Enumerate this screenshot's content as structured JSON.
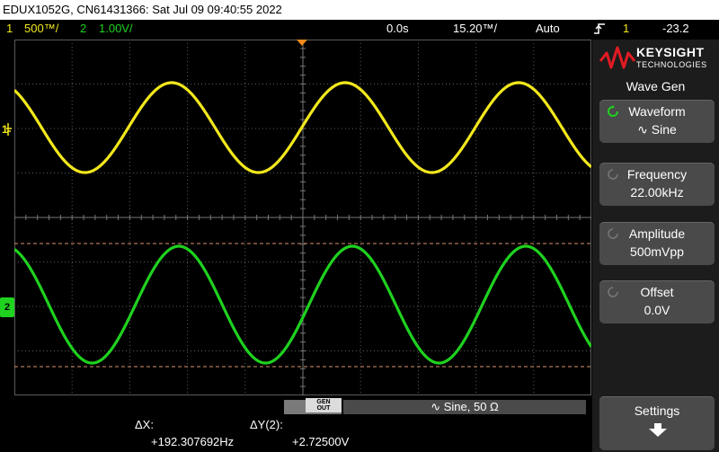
{
  "header": {
    "title": "EDUX1052G, CN61431366: Sat Jul 09 09:40:55 2022"
  },
  "status": {
    "ch1_num": "1",
    "ch1_scale": "500™/",
    "ch2_num": "2",
    "ch2_scale": "1.00V/",
    "delay": "0.0s",
    "timebase": "15.20™/",
    "trigger_mode": "Auto",
    "trigger_icon": "trigger-edge-icon",
    "trigger_source": "1",
    "trigger_level": "-23.2"
  },
  "markers": {
    "ch1": "1",
    "ch2": "2"
  },
  "panel": {
    "brand": "KEYSIGHT",
    "brand_sub": "TECHNOLOGIES",
    "menu_title": "Wave Gen",
    "waveform_label": "Waveform",
    "waveform_value": "∿ Sine",
    "frequency_label": "Frequency",
    "frequency_value": "22.00kHz",
    "amplitude_label": "Amplitude",
    "amplitude_value": "500mVpp",
    "offset_label": "Offset",
    "offset_value": "0.0V",
    "settings_label": "Settings"
  },
  "generator": {
    "gen_out": "GEN\nOUT",
    "info": "∿  Sine, 50 Ω"
  },
  "cursors": {
    "dx_label": "ΔX:",
    "dx_value": "+192.307692Hz",
    "dy_label": "ΔY(2):",
    "dy_value": "+2.72500V"
  },
  "colors": {
    "ch1": "#f2e81c",
    "ch2": "#1fd21f",
    "grid": "#5a5a5a",
    "cursor": "#d8926c",
    "accent": "#e31b23"
  }
}
